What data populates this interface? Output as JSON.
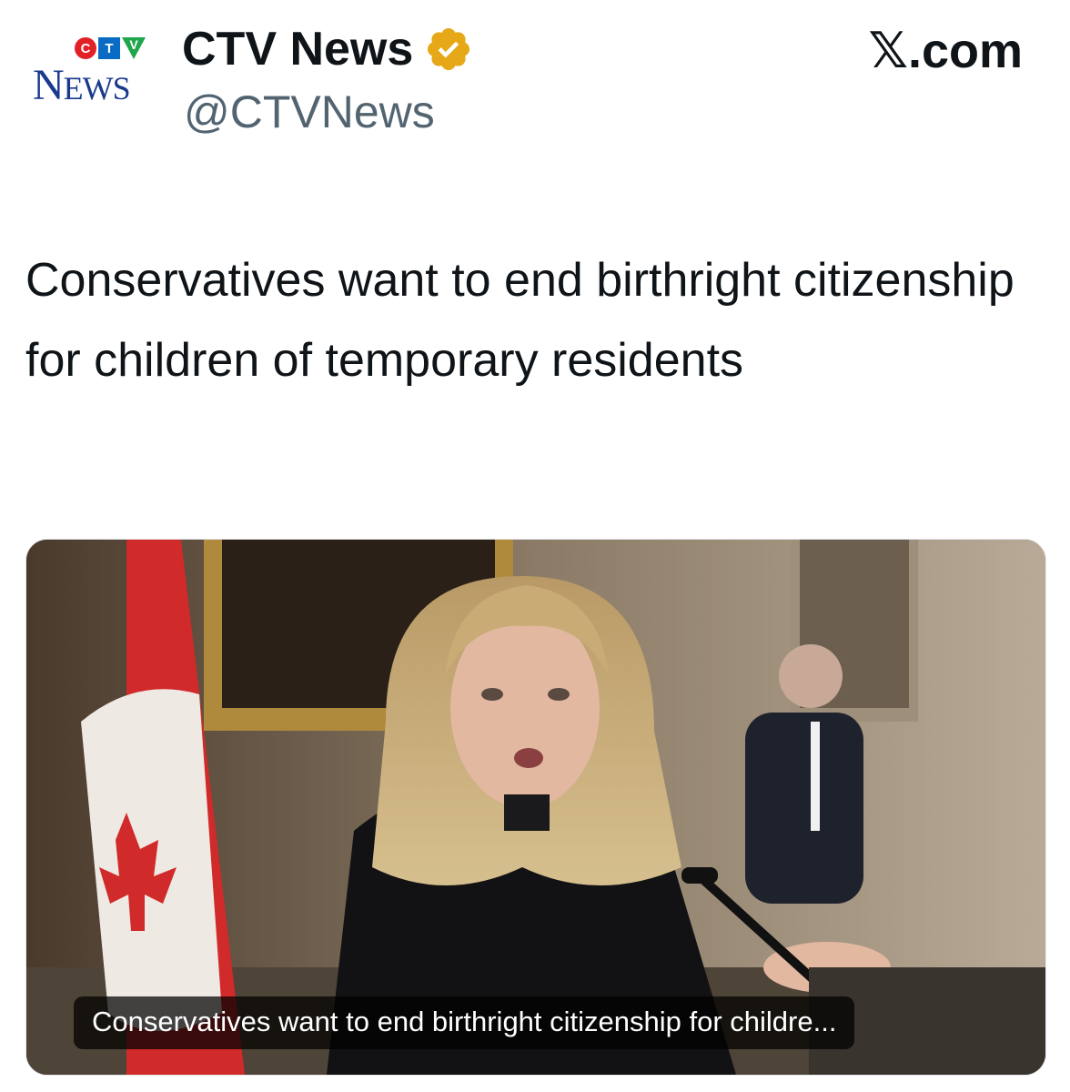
{
  "account": {
    "logo_mark": "CTV",
    "logo_word": "NEWS",
    "display_name": "CTV News",
    "handle": "@CTVNews",
    "verified": true,
    "verified_badge_color": "#e6a817"
  },
  "site_label": "𝕏.com",
  "post": {
    "text": "Conservatives want to end birthright citizenship for children of temporary residents"
  },
  "media": {
    "caption": "Conservatives want to end birthright citizenship for childre...",
    "image_subject": "speaker-at-microphone-photo"
  },
  "colors": {
    "text_primary": "#0f1419",
    "text_secondary": "#536471",
    "ctv_red": "#e22028",
    "ctv_blue": "#0a6bc4",
    "ctv_green": "#1fa64a",
    "news_navy": "#1a3a8c"
  }
}
